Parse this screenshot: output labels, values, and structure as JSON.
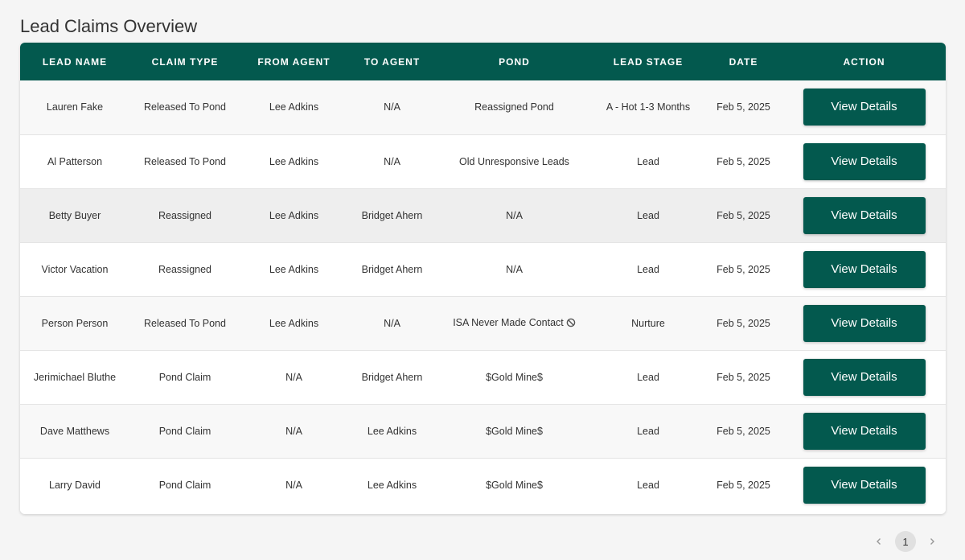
{
  "page": {
    "title": "Lead Claims Overview"
  },
  "table": {
    "headers": [
      "LEAD NAME",
      "CLAIM TYPE",
      "FROM AGENT",
      "TO AGENT",
      "POND",
      "LEAD STAGE",
      "DATE",
      "ACTION"
    ],
    "rows": [
      {
        "lead_name": "Lauren Fake",
        "claim_type": "Released To Pond",
        "from_agent": "Lee Adkins",
        "to_agent": "N/A",
        "pond": "Reassigned Pond",
        "lead_stage": "A - Hot 1-3 Months",
        "date": "Feb 5, 2025",
        "action": "View Details"
      },
      {
        "lead_name": "Al Patterson",
        "claim_type": "Released To Pond",
        "from_agent": "Lee Adkins",
        "to_agent": "N/A",
        "pond": "Old Unresponsive Leads",
        "lead_stage": "Lead",
        "date": "Feb 5, 2025",
        "action": "View Details"
      },
      {
        "lead_name": "Betty Buyer",
        "claim_type": "Reassigned",
        "from_agent": "Lee Adkins",
        "to_agent": "Bridget Ahern",
        "pond": "N/A",
        "lead_stage": "Lead",
        "date": "Feb 5, 2025",
        "action": "View Details"
      },
      {
        "lead_name": "Victor Vacation",
        "claim_type": "Reassigned",
        "from_agent": "Lee Adkins",
        "to_agent": "Bridget Ahern",
        "pond": "N/A",
        "lead_stage": "Lead",
        "date": "Feb 5, 2025",
        "action": "View Details"
      },
      {
        "lead_name": "Person Person",
        "claim_type": "Released To Pond",
        "from_agent": "Lee Adkins",
        "to_agent": "N/A",
        "pond": "ISA Never Made Contact",
        "lead_stage": "Nurture",
        "date": "Feb 5, 2025",
        "action": "View Details"
      },
      {
        "lead_name": "Jerimichael Bluthe",
        "claim_type": "Pond Claim",
        "from_agent": "N/A",
        "to_agent": "Bridget Ahern",
        "pond": "$Gold Mine$",
        "lead_stage": "Lead",
        "date": "Feb 5, 2025",
        "action": "View Details"
      },
      {
        "lead_name": "Dave Matthews",
        "claim_type": "Pond Claim",
        "from_agent": "N/A",
        "to_agent": "Lee Adkins",
        "pond": "$Gold Mine$",
        "lead_stage": "Lead",
        "date": "Feb 5, 2025",
        "action": "View Details"
      },
      {
        "lead_name": "Larry David",
        "claim_type": "Pond Claim",
        "from_agent": "N/A",
        "to_agent": "Lee Adkins",
        "pond": "$Gold Mine$",
        "lead_stage": "Lead",
        "date": "Feb 5, 2025",
        "action": "View Details"
      }
    ]
  },
  "icons": {
    "pond_row_5_icon": "ban-icon"
  },
  "pagination": {
    "current_page": "1",
    "prev_icon": "chevron-left-icon",
    "next_icon": "chevron-right-icon"
  },
  "colors": {
    "header_bg": "#03594e",
    "button_bg": "#03594e",
    "page_bg": "#f5f5f5"
  }
}
